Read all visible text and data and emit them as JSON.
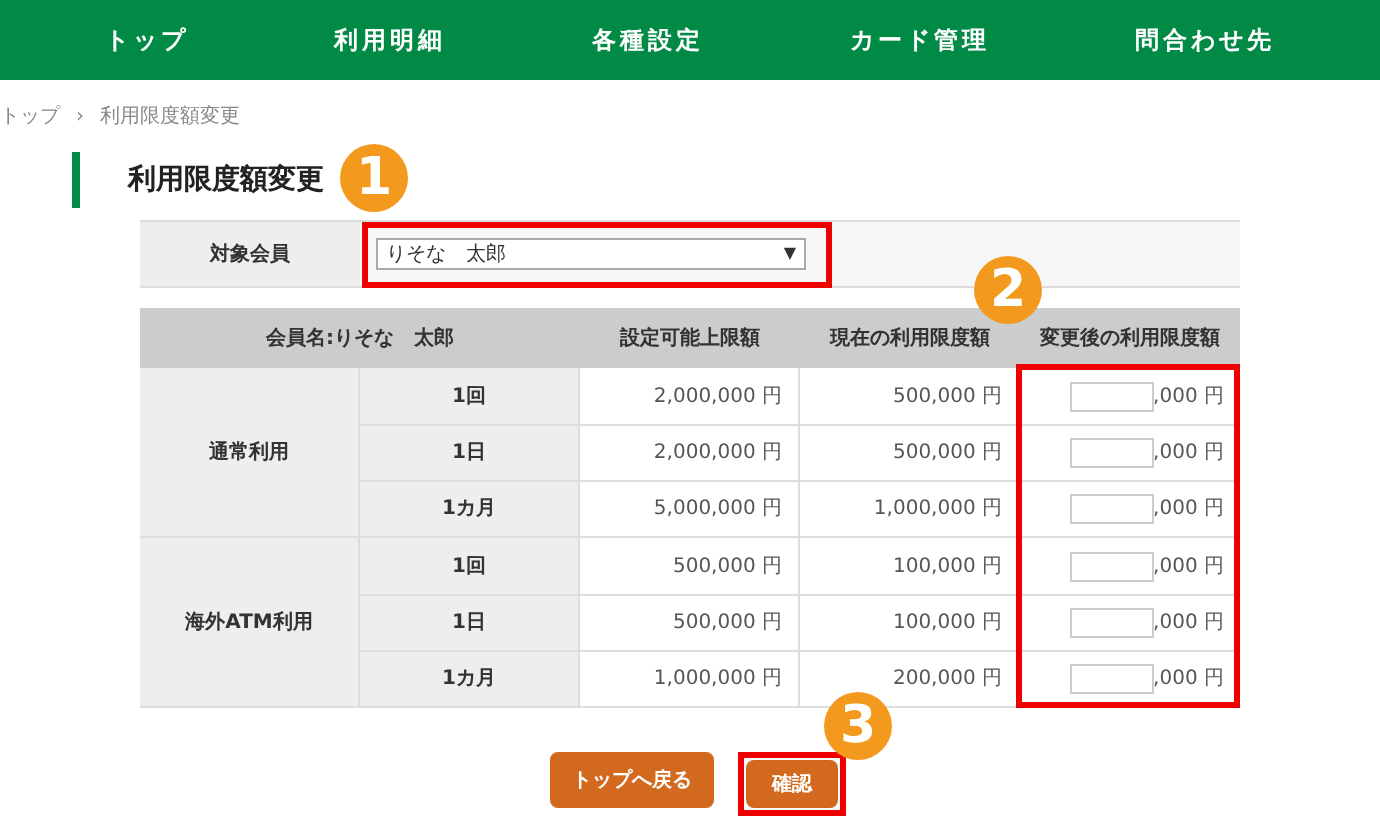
{
  "nav": [
    {
      "label": "トップ"
    },
    {
      "label": "利用明細"
    },
    {
      "label": "各種設定"
    },
    {
      "label": "カード管理"
    },
    {
      "label": "問合わせ先"
    }
  ],
  "breadcrumb": [
    "トップ",
    "›",
    "利用限度額変更"
  ],
  "title": "利用限度額変更",
  "member": {
    "label": "対象会員",
    "value": "りそな　太郎",
    "arrow": "▼"
  },
  "table": {
    "columns": [
      "会員名:りそな　太郎",
      "設定可能上限額",
      "現在の利用限度額",
      "変更後の利用限度額"
    ],
    "groups": [
      {
        "name": "通常利用",
        "rows": [
          {
            "period": "1回",
            "max": "2,000,000 円",
            "current": "500,000 円",
            "suffix": ",000 円"
          },
          {
            "period": "1日",
            "max": "2,000,000 円",
            "current": "500,000 円",
            "suffix": ",000 円"
          },
          {
            "period": "1カ月",
            "max": "5,000,000 円",
            "current": "1,000,000 円",
            "suffix": ",000 円"
          }
        ]
      },
      {
        "name": "海外ATM利用",
        "rows": [
          {
            "period": "1回",
            "max": "500,000 円",
            "current": "100,000 円",
            "suffix": ",000 円"
          },
          {
            "period": "1日",
            "max": "500,000 円",
            "current": "100,000 円",
            "suffix": ",000 円"
          },
          {
            "period": "1カ月",
            "max": "1,000,000 円",
            "current": "200,000 円",
            "suffix": ",000 円"
          }
        ]
      }
    ]
  },
  "buttons": [
    {
      "label": "トップへ戻る"
    },
    {
      "label": "確認"
    }
  ],
  "callouts": [
    "1",
    "2",
    "3"
  ]
}
